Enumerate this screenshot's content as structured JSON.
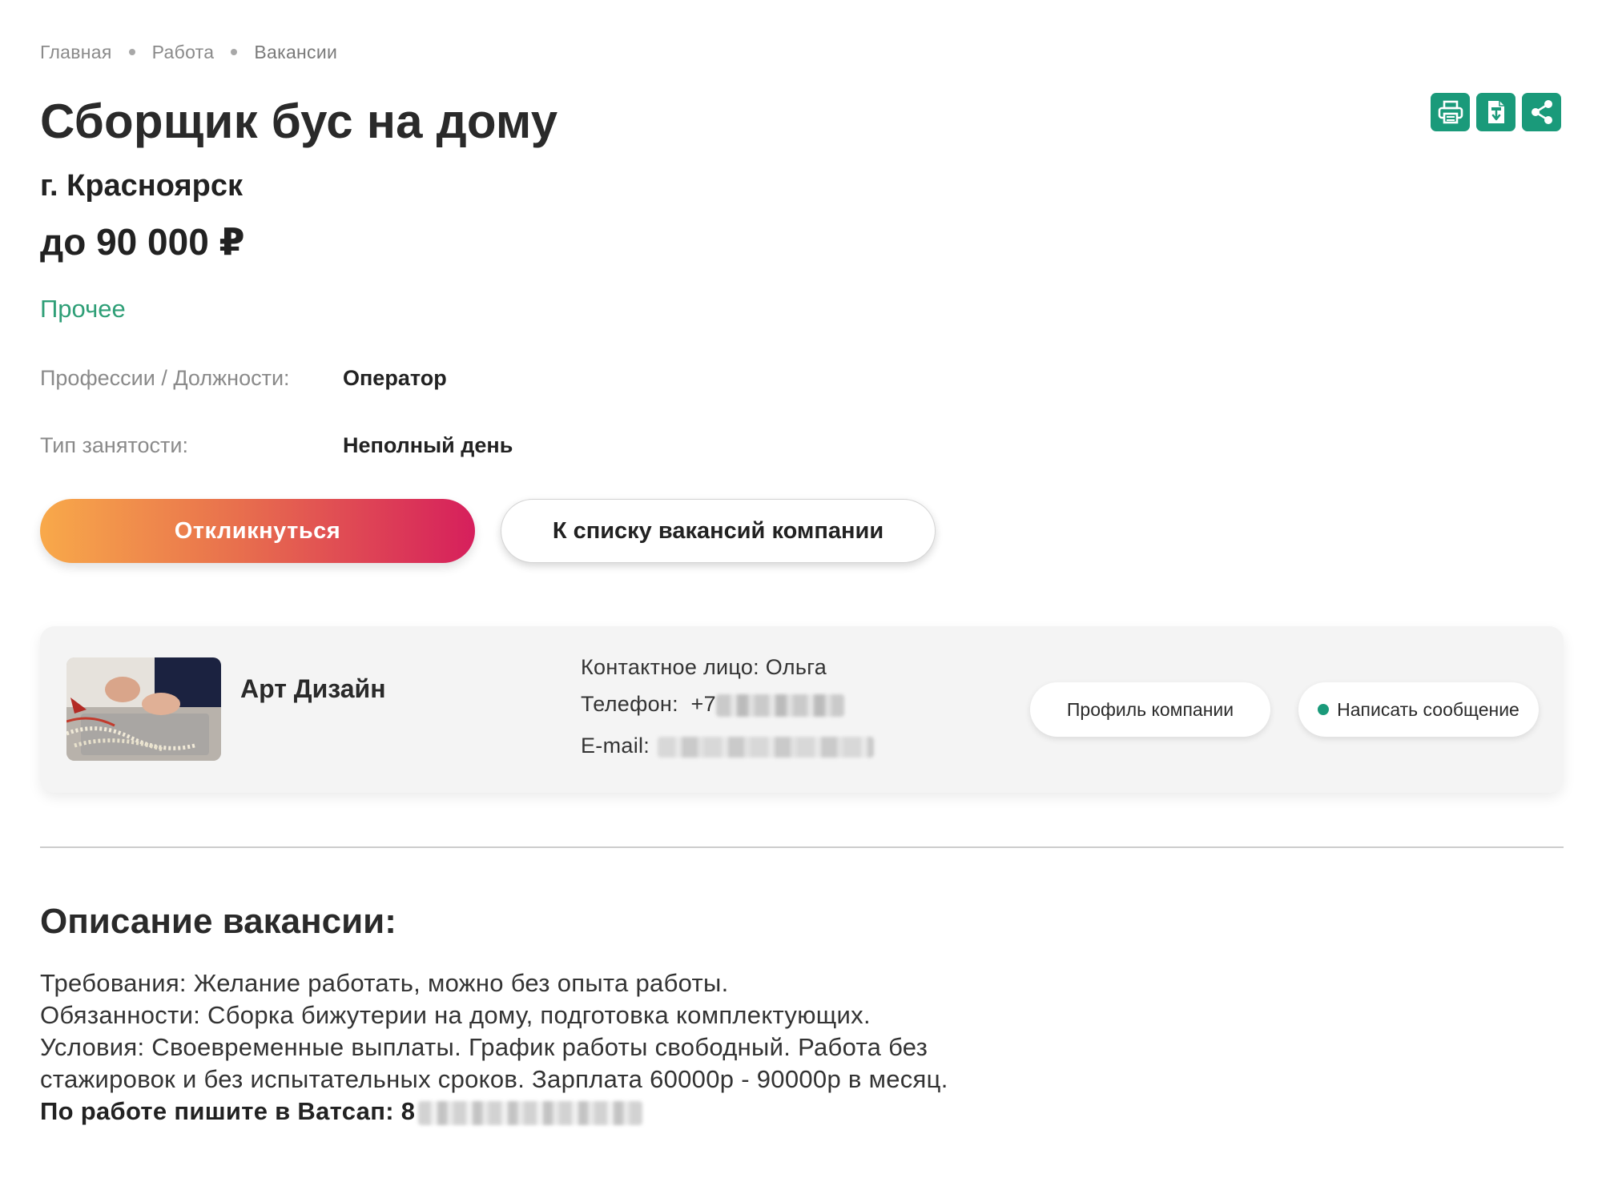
{
  "breadcrumb": {
    "items": [
      "Главная",
      "Работа",
      "Вакансии"
    ]
  },
  "vacancy": {
    "title": "Сборщик бус на дому",
    "city": "г. Красноярск",
    "salary": "до 90 000 ₽",
    "category": "Прочее",
    "attributes": {
      "profession_label": "Профессии / Должности:",
      "profession_value": "Оператор",
      "employment_label": "Тип занятости:",
      "employment_value": "Неполный день"
    }
  },
  "actions": {
    "apply_label": "Откликнуться",
    "company_list_label": "К списку вакансий компании"
  },
  "tools": {
    "icons": [
      "print-icon",
      "pdf-download-icon",
      "share-icon"
    ]
  },
  "company": {
    "name": "Арт Дизайн",
    "contact_person": "Контактное лицо: Ольга",
    "phone_label": "Телефон:",
    "phone_prefix": "+7",
    "email_label": "E-mail:",
    "profile_button": "Профиль компании",
    "message_button": "Написать сообщение"
  },
  "description": {
    "heading": "Описание вакансии:",
    "lines": [
      "Требования: Желание работать, можно без опыта работы.",
      "Обязанности: Сборка бижутерии на дому, подготовка комплектующих.",
      "Условия: Своевременные выплаты. График работы свободный. Работа без",
      "стажировок и без испытательных сроков. Зарплата 60000р - 90000р в месяц."
    ],
    "whatsapp_label": "По работе пишите в Ватсап: 8"
  },
  "colors": {
    "accent_green": "#1a9a7a",
    "category_green": "#2f9f77",
    "apply_gradient_start": "#f8a94a",
    "apply_gradient_end": "#d61f5c"
  }
}
